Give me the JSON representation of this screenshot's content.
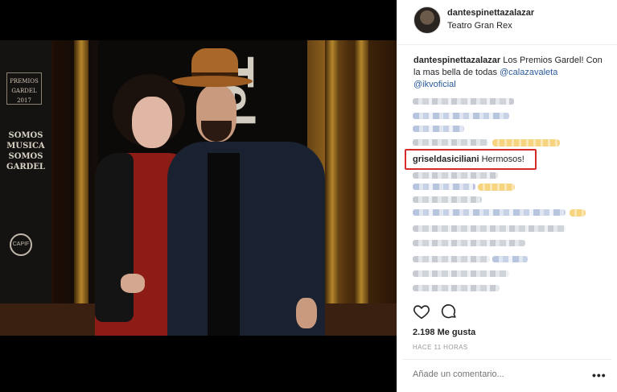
{
  "post": {
    "username": "dantespinettazalazar",
    "location": "Teatro Gran Rex",
    "caption_user": "dantespinettazalazar",
    "caption_text": " Los Premios Gardel! Con la mas bella de todas ",
    "mention_1": "@calazavaleta",
    "mention_2": "@ikvoficial"
  },
  "photo": {
    "banner_logo": "PREMIOS GARDEL 2017",
    "banner_text": "SOMOS MUSICA SOMOS GARDEL",
    "banner_badge": "CAPIF",
    "big_letters": "Tel"
  },
  "highlighted_comment": {
    "user": "griseldasiciliani",
    "text": " Hermosos!",
    "color": "#d42a2a"
  },
  "footer": {
    "likes": "2.198 Me gusta",
    "time_ago": "HACE 11 HORAS",
    "comment_placeholder": "Añade un comentario...",
    "more_label": "•••"
  },
  "icons": {
    "like": "heart-icon",
    "comment": "comment-icon"
  },
  "colors": {
    "mention": "#2a5a9a",
    "highlight": "#d42a2a"
  }
}
